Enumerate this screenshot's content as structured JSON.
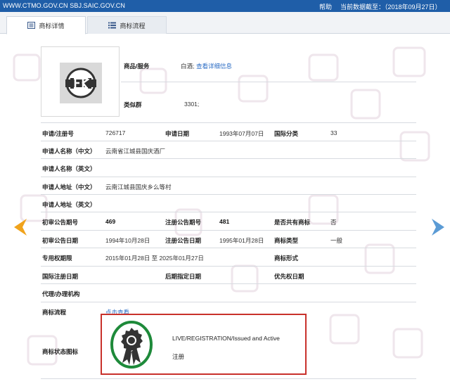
{
  "topbar": {
    "site": "WWW.CTMO.GOV.CN SBJ.SAIC.GOV.CN",
    "help": "帮助",
    "date_label": "当前数据截至：（2018年09月27日）"
  },
  "tabs": [
    {
      "label": "商标详情",
      "icon": "document-icon"
    },
    {
      "label": "商标流程",
      "icon": "list-icon"
    }
  ],
  "trademark_image": {
    "text": "国庆"
  },
  "goods": {
    "label": "商品/服务",
    "value": "白酒;",
    "link": "查看详细信息"
  },
  "similar_group": {
    "label": "类似群",
    "value": "3301;"
  },
  "rows": {
    "reg_no": {
      "label": "申请/注册号",
      "value": "726717"
    },
    "app_date": {
      "label": "申请日期",
      "value": "1993年07月07日"
    },
    "intl_class": {
      "label": "国际分类",
      "value": "33"
    },
    "applicant_cn": {
      "label": "申请人名称（中文）",
      "value": "云南省江城县国庆酒厂"
    },
    "applicant_en": {
      "label": "申请人名称（英文）",
      "value": ""
    },
    "address_cn": {
      "label": "申请人地址（中文）",
      "value": "云南江城县国庆乡么等村"
    },
    "address_en": {
      "label": "申请人地址（英文）",
      "value": ""
    },
    "prelim_no": {
      "label": "初审公告期号",
      "value": "469"
    },
    "reg_pub_no": {
      "label": "注册公告期号",
      "value": "481"
    },
    "shared": {
      "label": "是否共有商标",
      "value": "否"
    },
    "prelim_date": {
      "label": "初审公告日期",
      "value": "1994年10月28日"
    },
    "reg_pub_date": {
      "label": "注册公告日期",
      "value": "1995年01月28日"
    },
    "tm_type": {
      "label": "商标类型",
      "value": "一般"
    },
    "exclusive_period": {
      "label": "专用权期限",
      "value": "2015年01月28日 至 2025年01月27日"
    },
    "tm_form": {
      "label": "商标形式",
      "value": ""
    },
    "intl_reg_date": {
      "label": "国际注册日期",
      "value": ""
    },
    "later_date": {
      "label": "后期指定日期",
      "value": ""
    },
    "priority_date": {
      "label": "优先权日期",
      "value": ""
    },
    "agent": {
      "label": "代理/办理机构",
      "value": ""
    },
    "process": {
      "label": "商标流程",
      "link": "点击查看"
    },
    "status_icon": {
      "label": "商标状态图标"
    }
  },
  "status": {
    "en": "LIVE/REGISTRATION/Issued and Active",
    "cn": "注册"
  },
  "colors": {
    "topbar": "#1f5ea8",
    "arrow_left": "#f0a31c",
    "arrow_right": "#5b9bd5",
    "status_border": "#c8312b",
    "badge_ring": "#1e8a3a"
  }
}
